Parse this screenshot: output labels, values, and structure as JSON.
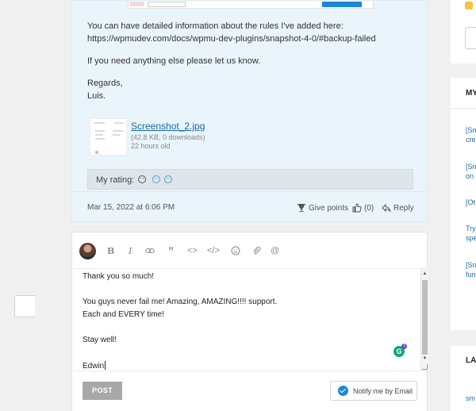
{
  "reply": {
    "paragraph1_line1": "You can have detailed information about the rules I've added here:",
    "paragraph1_link": "https://wpmudev.com/docs/wpmu-dev-plugins/snapshot-4-0/#backup-failed",
    "paragraph2": "If you need anything else please let us know.",
    "signoff1": "Regards,",
    "signoff2": "Luis.",
    "attachment": {
      "name": "Screenshot_2.jpg",
      "size": "(42.8 KB, 0 downloads)",
      "age": "22 hours old"
    },
    "rating_label": "My rating:",
    "date": "Mar 15, 2022 at 6:06 PM",
    "give_points": "Give points",
    "likes": "(0)",
    "reply_label": "Reply"
  },
  "editor": {
    "lines": [
      "Thank you so much!",
      "You guys never fail me!  Amazing,  AMAZING!!!! support.",
      "Each and EVERY time!",
      "Stay well!",
      "Edwin"
    ],
    "grammarly_count": "3",
    "post_label": "POST",
    "notify_label": "Notify me by Email"
  },
  "sidebar": {
    "heading1": "MY",
    "heading2": "LA",
    "links": [
      "[Sn",
      "cre",
      "[Sn",
      "on",
      "[Ot",
      "Try",
      "spe",
      "[Sn",
      "fun",
      "sm"
    ]
  },
  "colors": {
    "reply_bg": "#e9f4fb",
    "accent": "#1e88d6",
    "link": "#1a6aa6",
    "post_button": "#a8a8a8",
    "grammarly": "#13a680"
  }
}
